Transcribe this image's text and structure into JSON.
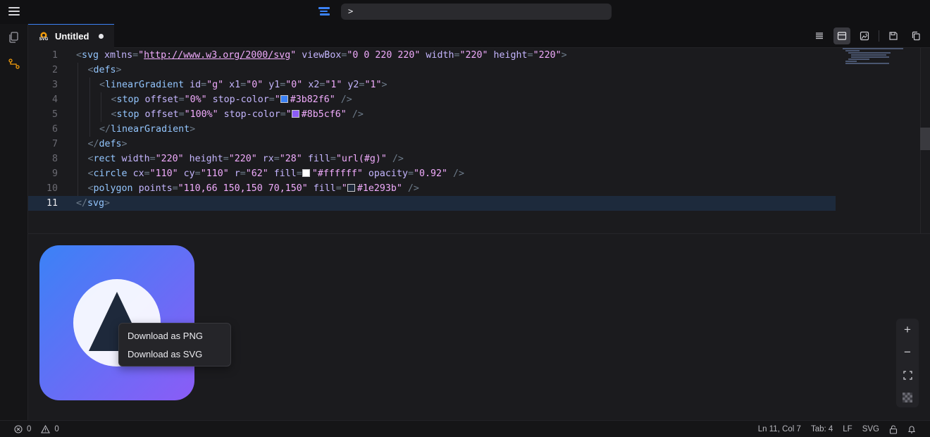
{
  "command_bar": {
    "value": ">"
  },
  "tab": {
    "label": "Untitled",
    "icon_label": "SVG"
  },
  "editor": {
    "line_numbers": [
      "1",
      "2",
      "3",
      "4",
      "5",
      "6",
      "7",
      "8",
      "9",
      "10",
      "11"
    ],
    "colors": {
      "c1": "#3b82f6",
      "c2": "#8b5cf6",
      "c3": "#ffffff",
      "c4": "#1e293b"
    },
    "tokens": {
      "l1": [
        "<",
        "svg",
        " xmlns",
        "=",
        "\"",
        "http://www.w3.org/2000/svg",
        "\"",
        " viewBox",
        "=",
        "\"0 0 220 220\"",
        " width",
        "=",
        "\"220\"",
        " height",
        "=",
        "\"220\"",
        ">"
      ],
      "l2": [
        "<",
        "defs",
        ">"
      ],
      "l3": [
        "<",
        "linearGradient",
        " id",
        "=",
        "\"g\"",
        " x1",
        "=",
        "\"0\"",
        " y1",
        "=",
        "\"0\"",
        " x2",
        "=",
        "\"1\"",
        " y2",
        "=",
        "\"1\"",
        ">"
      ],
      "l4": [
        "<",
        "stop",
        " offset",
        "=",
        "\"0%\"",
        " stop-color",
        "=",
        "\"",
        "#3b82f6",
        "\"",
        " />"
      ],
      "l5": [
        "<",
        "stop",
        " offset",
        "=",
        "\"100%\"",
        " stop-color",
        "=",
        "\"",
        "#8b5cf6",
        "\"",
        " />"
      ],
      "l6": [
        "</",
        "linearGradient",
        ">"
      ],
      "l7": [
        "</",
        "defs",
        ">"
      ],
      "l8": [
        "<",
        "rect",
        " width",
        "=",
        "\"220\"",
        " height",
        "=",
        "\"220\"",
        " rx",
        "=",
        "\"28\"",
        " fill",
        "=",
        "\"url(#g)\"",
        " />"
      ],
      "l9": [
        "<",
        "circle",
        " cx",
        "=",
        "\"110\"",
        " cy",
        "=",
        "\"110\"",
        " r",
        "=",
        "\"62\"",
        " fill",
        "=",
        "\"",
        "#ffffff",
        "\"",
        " opacity",
        "=",
        "\"0.92\"",
        " />"
      ],
      "l10": [
        "<",
        "polygon",
        " points",
        "=",
        "\"110,66 150,150 70,150\"",
        " fill",
        "=",
        "\"",
        "#1e293b",
        "\"",
        " />"
      ],
      "l11": [
        "</",
        "svg",
        ">"
      ]
    }
  },
  "preview": {
    "gradient_from": "#3b82f6",
    "gradient_to": "#8b5cf6",
    "circle_fill": "#ffffff",
    "circle_opacity": 0.92,
    "triangle_fill": "#1e293b"
  },
  "context_menu": {
    "items": [
      "Download as PNG",
      "Download as SVG"
    ]
  },
  "zoom_controls": {
    "zoom_in": "+",
    "zoom_out": "−"
  },
  "status": {
    "errors": "0",
    "warnings": "0",
    "position": "Ln 11, Col 7",
    "tab_size": "Tab: 4",
    "eol": "LF",
    "language": "SVG"
  },
  "icons": [
    "menu-icon",
    "app-logo-icon",
    "files-icon",
    "git-icon",
    "svg-file-icon",
    "wrap-icon",
    "layout-icon",
    "image-icon",
    "save-icon",
    "copy-icon",
    "error-icon",
    "warning-icon",
    "lock-icon",
    "bell-icon",
    "fullscreen-icon",
    "checkerboard-icon"
  ]
}
